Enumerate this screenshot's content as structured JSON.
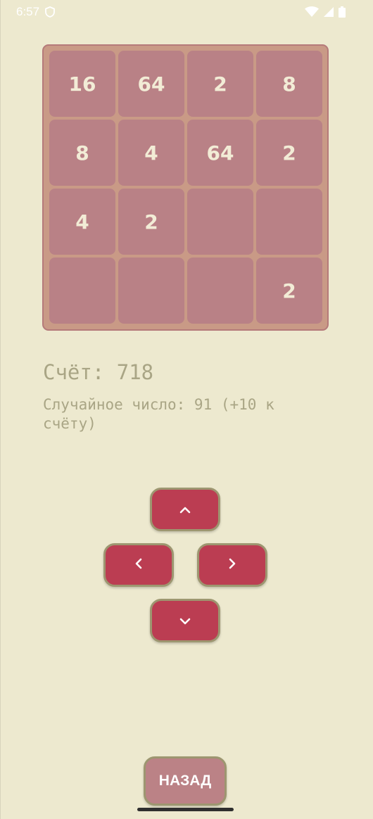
{
  "status_bar": {
    "time": "6:57",
    "icons": [
      "shield-icon",
      "wifi-icon",
      "signal-icon",
      "battery-icon"
    ]
  },
  "board": {
    "tiles": [
      "16",
      "64",
      "2",
      "8",
      "8",
      "4",
      "64",
      "2",
      "4",
      "2",
      "",
      "",
      "",
      "",
      "",
      "2"
    ]
  },
  "score": {
    "text": "Счёт: 718"
  },
  "random": {
    "text": "Случайное число: 91 (+10 к счёту)"
  },
  "controls": {
    "up_icon": "chevron-up-icon",
    "left_icon": "chevron-left-icon",
    "right_icon": "chevron-right-icon",
    "down_icon": "chevron-down-icon"
  },
  "back_button": {
    "label": "НАЗАД"
  },
  "colors": {
    "background": "#ede9cf",
    "board": "#c99a86",
    "tile": "#b98186",
    "tile_text": "#f2ecd6",
    "arrow_button": "#bb3d52",
    "back_button": "#bb8286",
    "score_text": "#a9a585"
  }
}
